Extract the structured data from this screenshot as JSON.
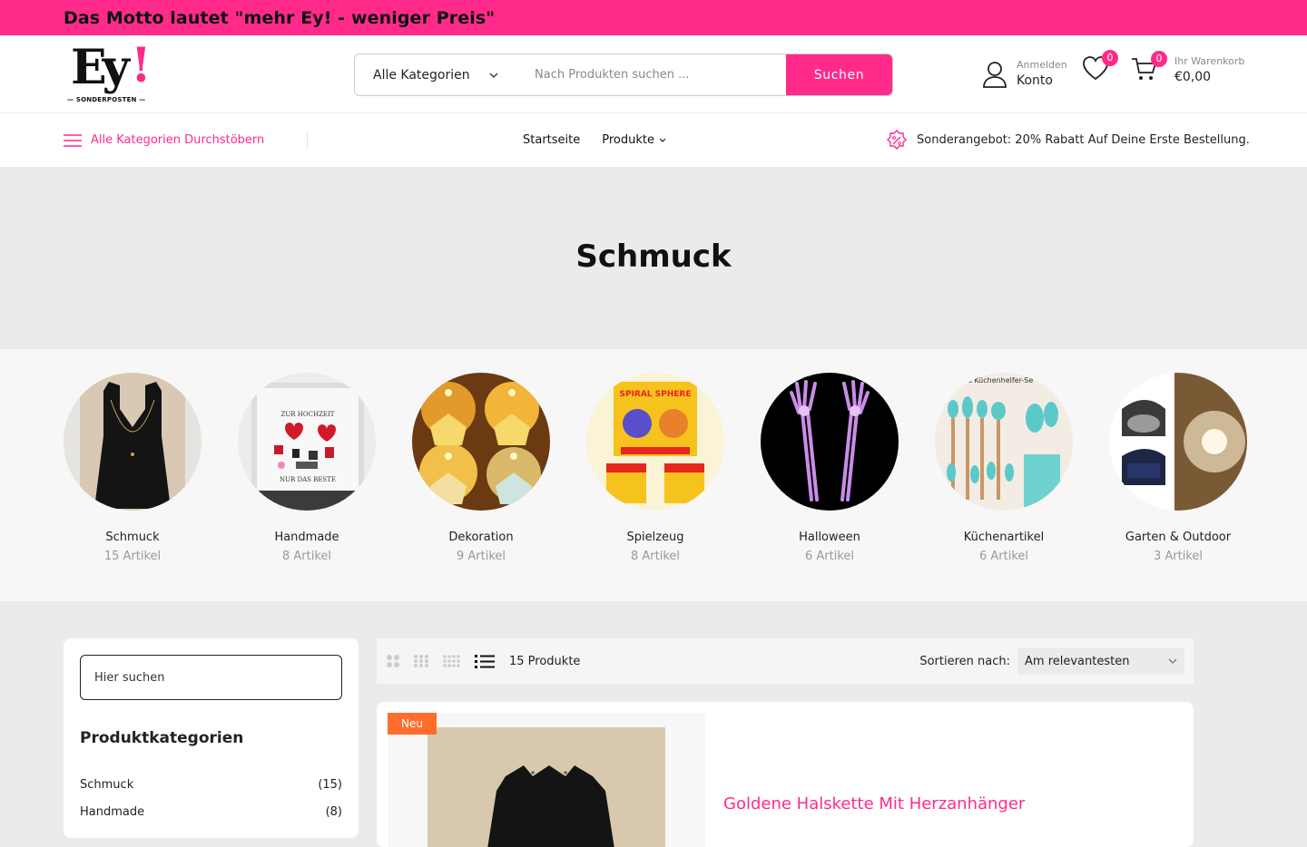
{
  "topbar": {
    "motto": "Das Motto lautet \"mehr Ey! - weniger Preis\""
  },
  "logo": {
    "text": "Ey",
    "mark": "!",
    "sub": "— SONDERPOSTEN —"
  },
  "search": {
    "category": "Alle Kategorien",
    "placeholder": "Nach Produkten suchen ...",
    "button": "Suchen"
  },
  "account": {
    "small": "Anmelden",
    "big": "Konto",
    "icon": "user-icon"
  },
  "wishlist": {
    "count": "0",
    "icon": "heart-icon"
  },
  "cart": {
    "count": "0",
    "small": "Ihr Warenkorb",
    "total": "€0,00",
    "icon": "cart-icon"
  },
  "nav": {
    "all_categories": "Alle Kategorien Durchstöbern",
    "links": [
      "Startseite",
      "Produkte"
    ],
    "offer": "Sonderangebot: 20% Rabatt Auf Deine Erste Bestellung."
  },
  "hero": {
    "title": "Schmuck"
  },
  "categories": [
    {
      "name": "Schmuck",
      "count": "15 Artikel"
    },
    {
      "name": "Handmade",
      "count": "8 Artikel"
    },
    {
      "name": "Dekoration",
      "count": "9 Artikel"
    },
    {
      "name": "Spielzeug",
      "count": "8 Artikel"
    },
    {
      "name": "Halloween",
      "count": "6 Artikel"
    },
    {
      "name": "Küchenartikel",
      "count": "6 Artikel"
    },
    {
      "name": "Garten & Outdoor",
      "count": "3 Artikel"
    }
  ],
  "category_image_text": {
    "handmade": [
      "ZUR HOCHZEIT",
      "NUR DAS BESTE"
    ],
    "spielzeug": "SPIRAL SPHERE",
    "kueche": "es Küchenhelfer-Se"
  },
  "sidebar": {
    "search_placeholder": "Hier suchen",
    "title": "Produktkategorien",
    "rows": [
      {
        "name": "Schmuck",
        "count": "(15)"
      },
      {
        "name": "Handmade",
        "count": "(8)"
      }
    ]
  },
  "toolbar": {
    "count": "15 Produkte",
    "sort_label": "Sortieren nach:",
    "sort_value": "Am relevantesten"
  },
  "product": {
    "badge": "Neu",
    "title": "Goldene Halskette Mit Herzanhänger"
  },
  "colors": {
    "accent": "#ff2a8a",
    "badge": "#ff6d2d"
  }
}
